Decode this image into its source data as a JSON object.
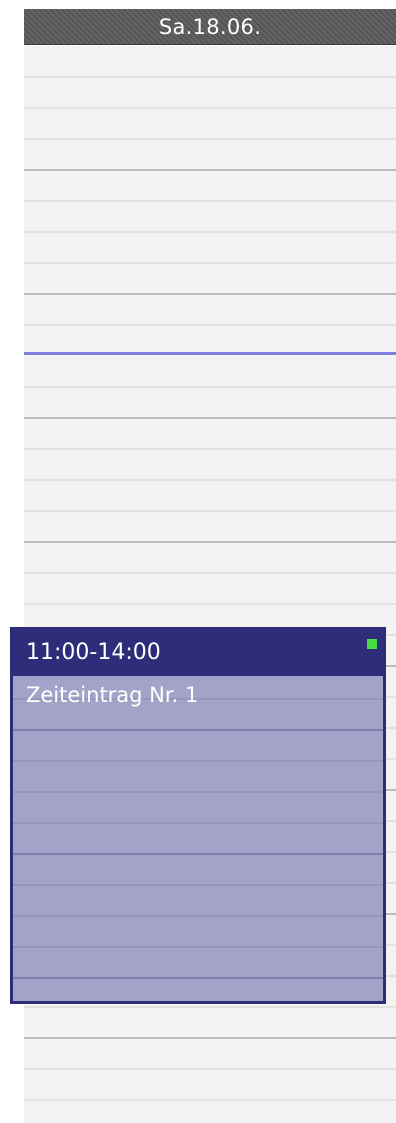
{
  "day_header": {
    "label": "Sa.18.06."
  },
  "event": {
    "time_range": "11:00-14:00",
    "title": "Zeiteintrag Nr. 1",
    "status_color": "#44dd44",
    "body_color": "#a3a3c9",
    "header_color": "#2d2d7a"
  },
  "colors": {
    "now_indicator": "#8080e0",
    "column_background": "#f3f3f3",
    "header_background": "#5a5a5a"
  }
}
